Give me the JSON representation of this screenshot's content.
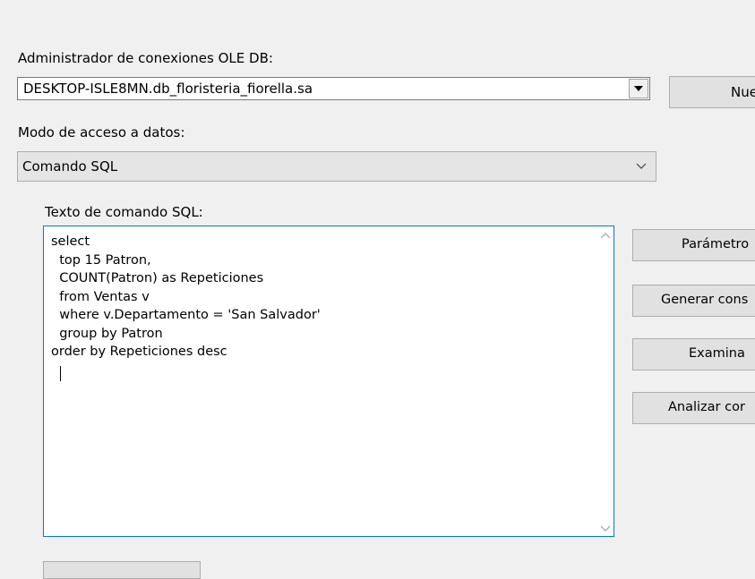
{
  "oledb": {
    "label": "Administrador de conexiones OLE DB:",
    "value": "DESKTOP-ISLE8MN.db_floristeria_fiorella.sa",
    "new_button": "Nuev"
  },
  "access_mode": {
    "label": "Modo de acceso a datos:",
    "value": "Comando SQL"
  },
  "sql": {
    "label": "Texto de comando SQL:",
    "text": "select\n  top 15 Patron,\n  COUNT(Patron) as Repeticiones\n  from Ventas v\n  where v.Departamento = 'San Salvador'\n  group by Patron\norder by Repeticiones desc"
  },
  "buttons": {
    "params": "Parámetro",
    "generate": "Generar cons",
    "browse": "Examina",
    "analyze": "Analizar cor"
  },
  "icons": {
    "dropdown": "triangle-down-icon",
    "chevron": "chevron-down-icon",
    "scroll_up": "scroll-up-icon",
    "scroll_down": "scroll-down-icon"
  }
}
